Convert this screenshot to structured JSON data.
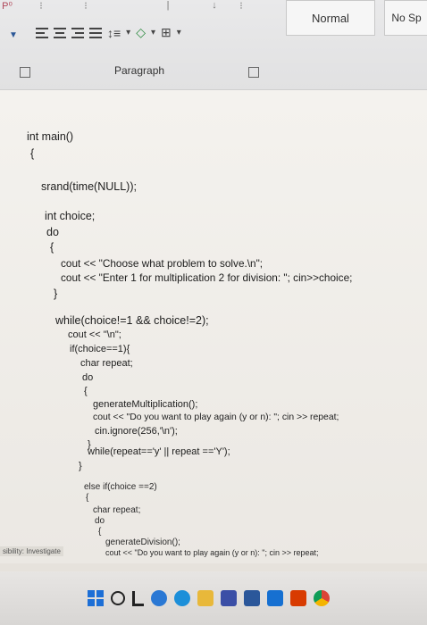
{
  "ribbon": {
    "styles": [
      "Normal",
      "No Sp"
    ],
    "group_label": "Paragraph"
  },
  "document": {
    "lines": [
      "int main()",
      "{",
      "srand(time(NULL));",
      "int choice;",
      "do",
      "{",
      "cout << \"Choose what problem to solve.\\n\";",
      "cout << \"Enter 1 for multiplication 2 for division: \"; cin>>choice;",
      "}",
      "while(choice!=1 && choice!=2);",
      "cout << \"\\n\";",
      "if(choice==1){",
      "char repeat;",
      "do",
      "{",
      "generateMultiplication();",
      "cout << \"Do you want to play again (y or n): \"; cin >> repeat;",
      "cin.ignore(256,'\\n');",
      "}",
      "while(repeat=='y' || repeat =='Y');",
      "}",
      "else if(choice ==2)",
      "{",
      "char repeat;",
      "do",
      "{",
      "generateDivision();",
      "cout << \"Do you want to play again (y or n): \"; cin >> repeat;"
    ]
  },
  "margin_note": "sibility: Investigate",
  "taskbar_icons": [
    "windows-start",
    "search",
    "task-view",
    "cortana",
    "edge",
    "file-explorer",
    "store",
    "word",
    "mail",
    "office",
    "chrome"
  ]
}
